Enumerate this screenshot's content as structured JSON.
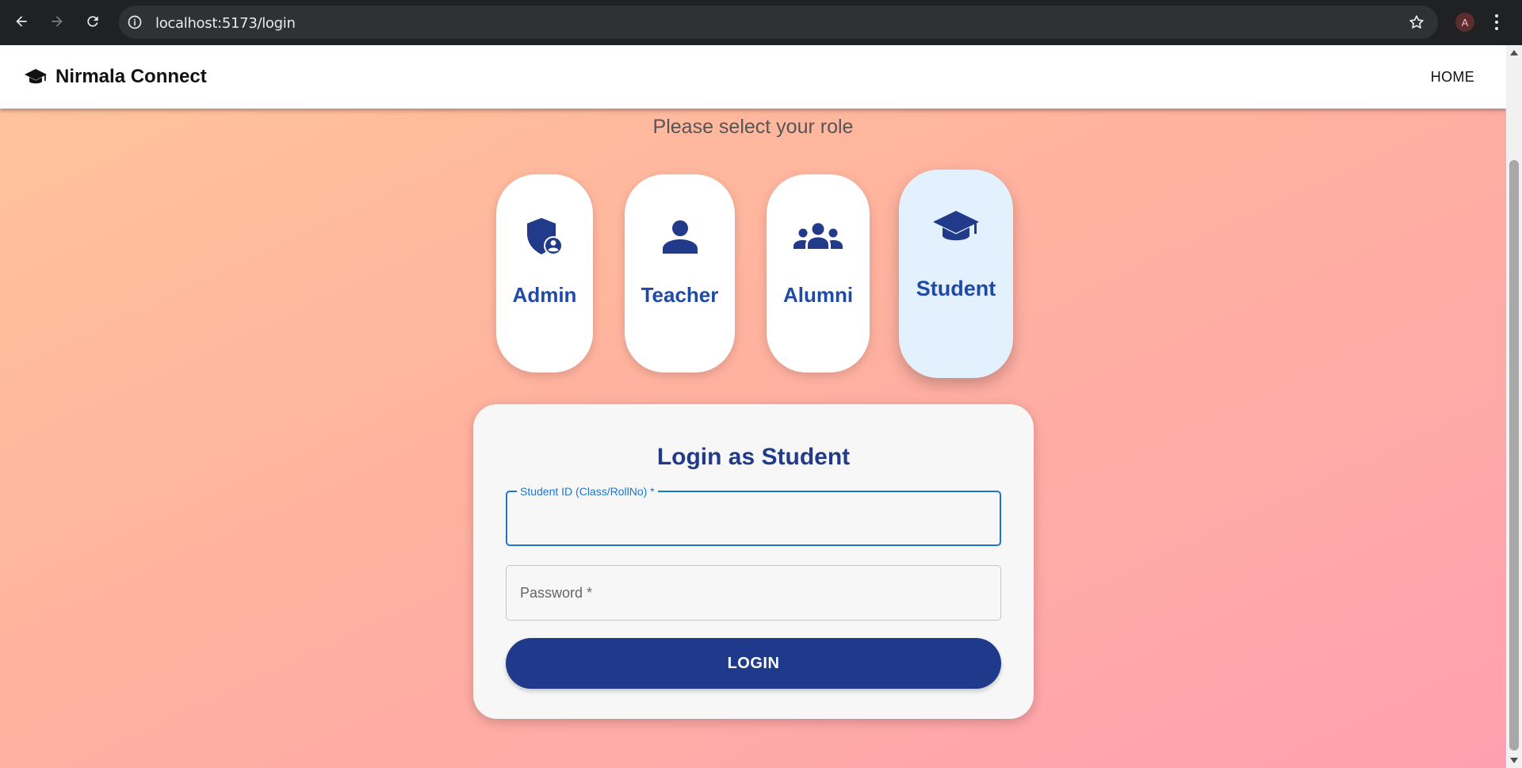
{
  "browser": {
    "url": "localhost:5173/login",
    "profile_initial": "A"
  },
  "appbar": {
    "brand": "Nirmala Connect",
    "home_link": "HOME"
  },
  "role_select": {
    "prompt": "Please select your role",
    "roles": [
      {
        "label": "Admin",
        "icon": "admin-shield-icon"
      },
      {
        "label": "Teacher",
        "icon": "person-icon"
      },
      {
        "label": "Alumni",
        "icon": "group-icon"
      },
      {
        "label": "Student",
        "icon": "graduation-cap-icon",
        "selected": true
      }
    ]
  },
  "login": {
    "title": "Login as Student",
    "student_id_label": "Student ID (Class/RollNo) *",
    "student_id_value": "",
    "password_placeholder": "Password *",
    "password_value": "",
    "button_label": "LOGIN"
  },
  "colors": {
    "primary": "#1f3a8a",
    "role_label": "#1f4aa6",
    "focus": "#1976d2",
    "selected_card": "#e3f0fd"
  }
}
